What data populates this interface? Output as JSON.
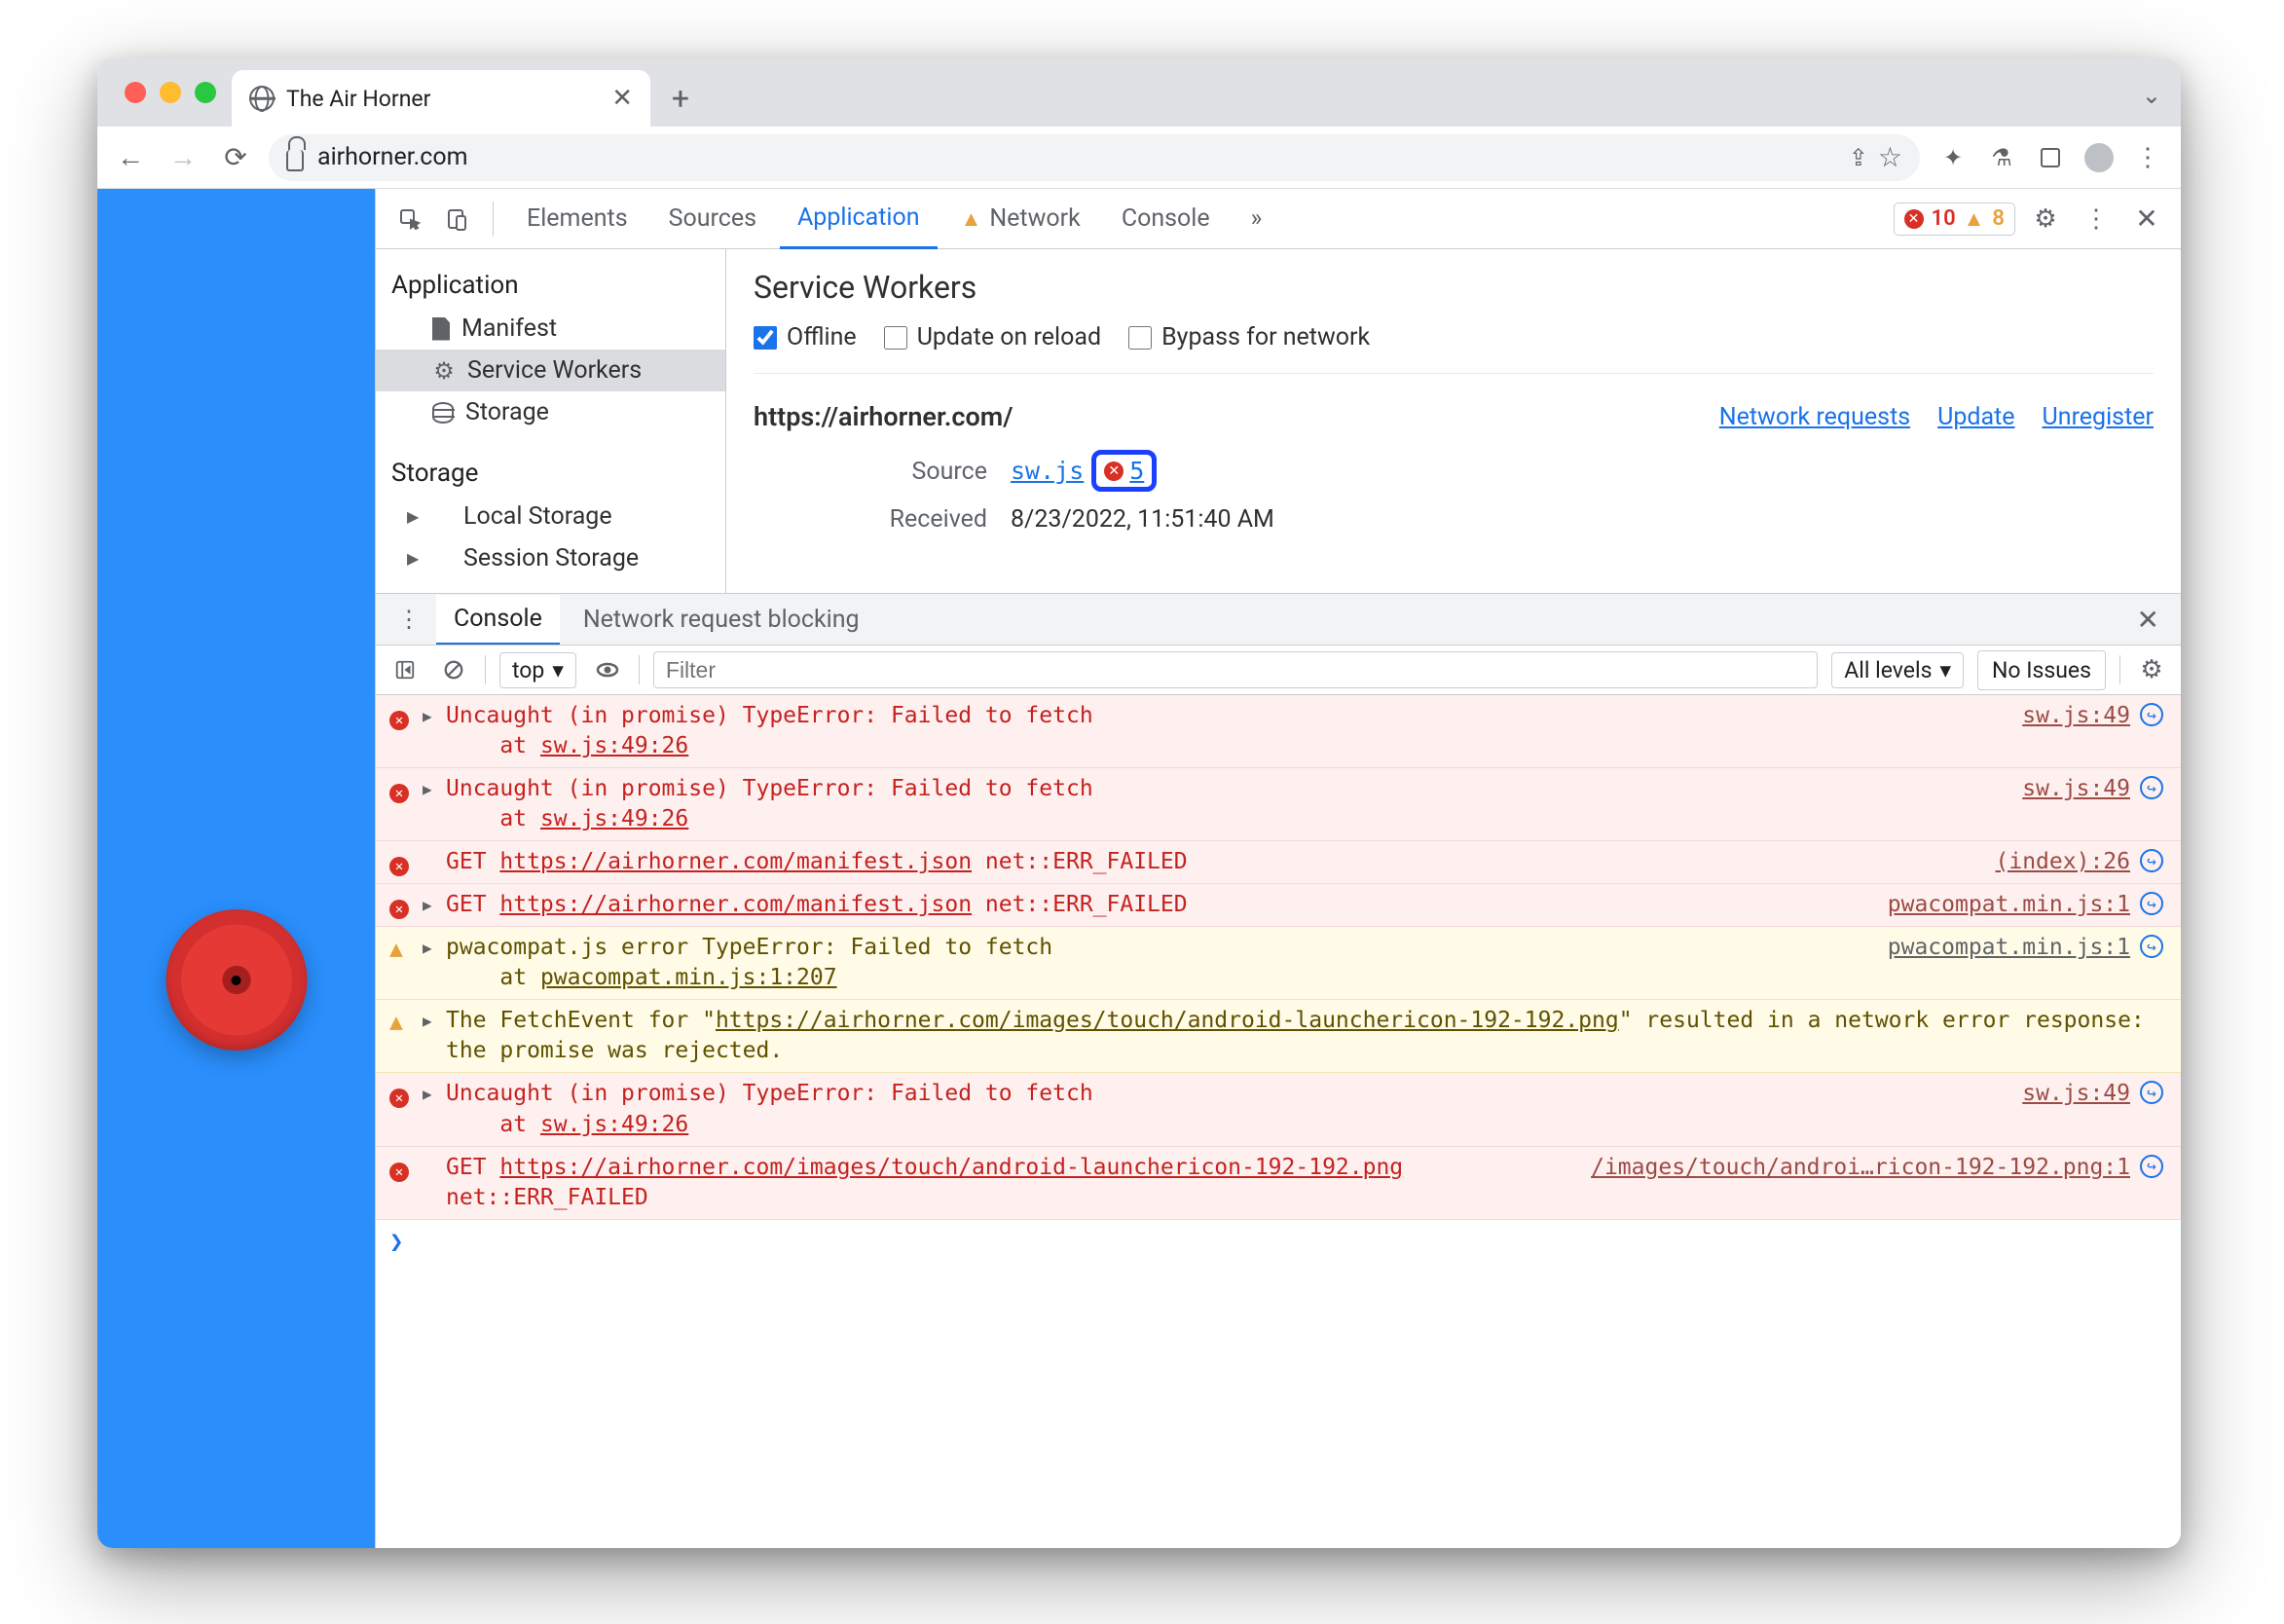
{
  "tab": {
    "title": "The Air Horner"
  },
  "omnibox": {
    "url": "airhorner.com"
  },
  "devtools": {
    "tabs": {
      "elements": "Elements",
      "sources": "Sources",
      "application": "Application",
      "network": "Network",
      "console": "Console"
    },
    "errors": "10",
    "warnings": "8"
  },
  "sidebar": {
    "application": {
      "header": "Application",
      "manifest": "Manifest",
      "service_workers": "Service Workers",
      "storage": "Storage"
    },
    "storage": {
      "header": "Storage",
      "local": "Local Storage",
      "session": "Session Storage"
    }
  },
  "sw": {
    "title": "Service Workers",
    "offline": "Offline",
    "update_on_reload": "Update on reload",
    "bypass": "Bypass for network",
    "origin": "https://airhorner.com/",
    "links": {
      "network": "Network requests",
      "update": "Update",
      "unregister": "Unregister"
    },
    "source_label": "Source",
    "source_link": "sw.js",
    "error_count": "5",
    "received_label": "Received",
    "received_value": "8/23/2022, 11:51:40 AM"
  },
  "drawer": {
    "tabs": {
      "console": "Console",
      "nrb": "Network request blocking"
    },
    "toolbar": {
      "context": "top",
      "filter_placeholder": "Filter",
      "levels": "All levels",
      "issues": "No Issues"
    }
  },
  "log": [
    {
      "type": "err",
      "disc": true,
      "msg": "Uncaught (in promise) TypeError: Failed to fetch\n    at ",
      "link_in": "sw.js:49:26",
      "src": "sw.js:49"
    },
    {
      "type": "err",
      "disc": true,
      "msg": "Uncaught (in promise) TypeError: Failed to fetch\n    at ",
      "link_in": "sw.js:49:26",
      "src": "sw.js:49"
    },
    {
      "type": "err",
      "disc": false,
      "msg": "GET ",
      "link_in": "https://airhorner.com/manifest.json",
      "tail": " net::ERR_FAILED",
      "src": "(index):26"
    },
    {
      "type": "err",
      "disc": true,
      "msg": "GET ",
      "link_in": "https://airhorner.com/manifest.json",
      "tail": " net::ERR_FAILED",
      "src": "pwacompat.min.js:1"
    },
    {
      "type": "warn",
      "disc": true,
      "msg": "pwacompat.js error TypeError: Failed to fetch\n    at ",
      "link_in": "pwacompat.min.js:1:207",
      "src": "pwacompat.min.js:1"
    },
    {
      "type": "warn",
      "disc": true,
      "msg": "The FetchEvent for \"",
      "link_in": "https://airhorner.com/images/touch/android-launchericon-192-192.png",
      "tail": "\" resulted in a network error response: the promise was rejected.",
      "src": ""
    },
    {
      "type": "err",
      "disc": true,
      "msg": "Uncaught (in promise) TypeError: Failed to fetch\n    at ",
      "link_in": "sw.js:49:26",
      "src": "sw.js:49"
    },
    {
      "type": "err",
      "disc": false,
      "msg": "GET ",
      "link_in": "https://airhorner.com/images/touch/android-launchericon-192-192.png",
      "tail": " net::ERR_FAILED",
      "src": "/images/touch/androi…ricon-192-192.png:1"
    }
  ]
}
